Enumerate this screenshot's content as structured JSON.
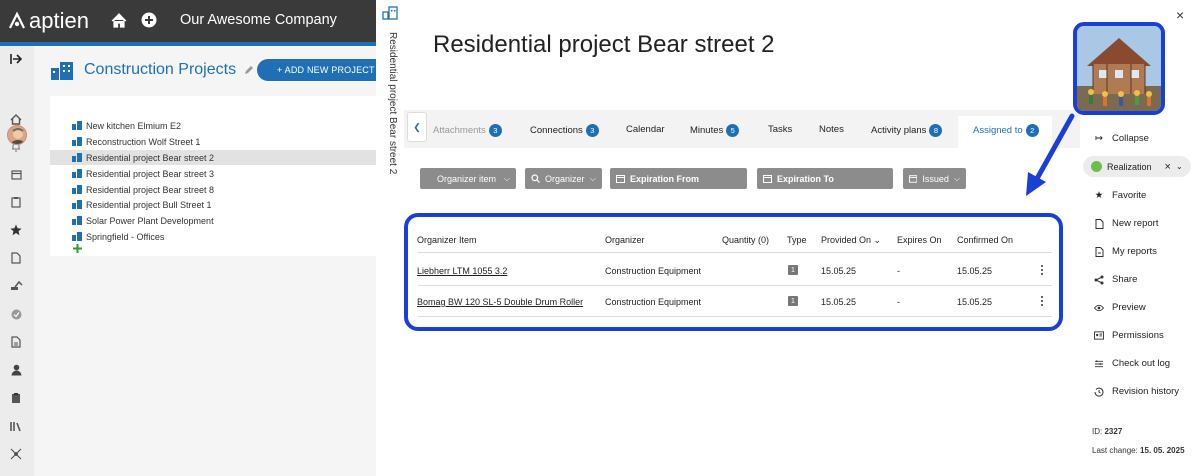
{
  "app": {
    "logo_text": "aptien",
    "company": "Our Awesome Company"
  },
  "left_panel": {
    "title": "Construction Projects",
    "add_button": "+ ADD NEW PROJECT",
    "projects": [
      {
        "label": "New kitchen Elmium E2",
        "selected": false
      },
      {
        "label": "Reconstruction Wolf Street 1",
        "selected": false
      },
      {
        "label": "Residential project Bear street 2",
        "selected": true
      },
      {
        "label": "Residential project Bear street 3",
        "selected": false
      },
      {
        "label": "Residential project Bear street 8",
        "selected": false
      },
      {
        "label": "Residential project Bull Street 1",
        "selected": false
      },
      {
        "label": "Solar Power Plant Development",
        "selected": false
      },
      {
        "label": "Springfield - Offices",
        "selected": false
      }
    ]
  },
  "vertical_title": "Residential project Bear street 2",
  "main": {
    "title": "Residential project Bear street 2",
    "tabs": [
      {
        "label": "Attachments",
        "badge": "3"
      },
      {
        "label": "Connections",
        "badge": "3"
      },
      {
        "label": "Calendar",
        "badge": ""
      },
      {
        "label": "Minutes",
        "badge": "5"
      },
      {
        "label": "Tasks",
        "badge": ""
      },
      {
        "label": "Notes",
        "badge": ""
      },
      {
        "label": "Activity plans",
        "badge": "8"
      },
      {
        "label": "Assigned to",
        "badge": "2"
      }
    ],
    "active_tab": "Assigned to",
    "filters": {
      "organizer_item": "Organizer item",
      "organizer": "Organizer",
      "expiration_from": "Expiration From",
      "expiration_to": "Expiration To",
      "issued": "Issued"
    },
    "table": {
      "headers": [
        "Organizer Item",
        "Organizer",
        "Quantity (0)",
        "Type",
        "Provided On",
        "Expires On",
        "Confirmed On"
      ],
      "rows": [
        {
          "item": "Liebherr LTM 1055 3.2",
          "organizer": "Construction Equipment",
          "quantity": "",
          "type": "1",
          "provided": "15.05.25",
          "expires": "-",
          "confirmed": "15.05.25"
        },
        {
          "item": "Bomag BW 120 SL-5 Double Drum Roller",
          "organizer": "Construction Equipment",
          "quantity": "",
          "type": "1",
          "provided": "15.05.25",
          "expires": "-",
          "confirmed": "15.05.25"
        }
      ]
    }
  },
  "right_panel": {
    "close": "×",
    "collapse": "Collapse",
    "status": "Realization",
    "status_color": "#6cc04a",
    "actions": [
      "Favorite",
      "New report",
      "My reports",
      "Share",
      "Preview",
      "Permissions",
      "Check out log",
      "Revision history"
    ],
    "id_label": "ID:",
    "id_value": "2327",
    "last_change_label": "Last change:",
    "last_change_value": "15. 05. 2025"
  },
  "colors": {
    "brand": "#1f6fb5",
    "highlight": "#1a3fd6",
    "topbar": "#3a3a3a"
  }
}
